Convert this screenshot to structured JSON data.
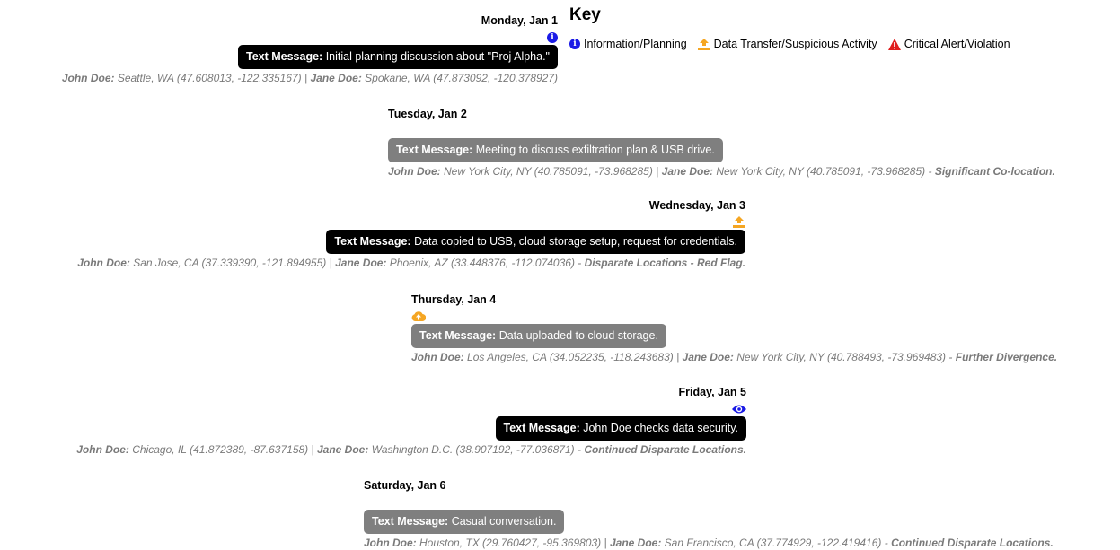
{
  "key": {
    "title": "Key",
    "items": [
      {
        "icon": "info-icon",
        "label": "Information/Planning",
        "color": "#1a1ae6"
      },
      {
        "icon": "upload-icon",
        "label": "Data Transfer/Suspicious Activity",
        "color": "#f5a623"
      },
      {
        "icon": "warning-icon",
        "label": "Critical Alert/Violation",
        "color": "#e01e1e"
      }
    ]
  },
  "events": [
    {
      "date": "Monday, Jan 1",
      "icon": "info-icon",
      "message_prefix": "Text Message:",
      "message": "Initial planning discussion about \"Proj Alpha.\"",
      "john_label": "John Doe:",
      "john_loc": "Seattle, WA (47.608013, -122.335167)",
      "sep": "|",
      "jane_label": "Jane Doe:",
      "jane_loc": "Spokane, WA (47.873092, -120.378927)",
      "note": ""
    },
    {
      "date": "Tuesday, Jan 2",
      "icon": "",
      "message_prefix": "Text Message:",
      "message": "Meeting to discuss exfiltration plan & USB drive.",
      "john_label": "John Doe:",
      "john_loc": "New York City, NY (40.785091, -73.968285)",
      "sep": "|",
      "jane_label": "Jane Doe:",
      "jane_loc": "New York City, NY (40.785091, -73.968285) -",
      "note": "Significant Co-location."
    },
    {
      "date": "Wednesday, Jan 3",
      "icon": "upload-icon",
      "message_prefix": "Text Message:",
      "message": "Data copied to USB, cloud storage setup, request for credentials.",
      "john_label": "John Doe:",
      "john_loc": "San Jose, CA (37.339390, -121.894955)",
      "sep": "|",
      "jane_label": "Jane Doe:",
      "jane_loc": "Phoenix, AZ (33.448376, -112.074036) -",
      "note": "Disparate Locations - Red Flag."
    },
    {
      "date": "Thursday, Jan 4",
      "icon": "cloud-upload-icon",
      "message_prefix": "Text Message:",
      "message": "Data uploaded to cloud storage.",
      "john_label": "John Doe:",
      "john_loc": "Los Angeles, CA (34.052235, -118.243683)",
      "sep": "|",
      "jane_label": "Jane Doe:",
      "jane_loc": "New York City, NY (40.788493, -73.969483) -",
      "note": "Further Divergence."
    },
    {
      "date": "Friday, Jan 5",
      "icon": "eye-icon",
      "message_prefix": "Text Message:",
      "message": "John Doe checks data security.",
      "john_label": "John Doe:",
      "john_loc": "Chicago, IL (41.872389, -87.637158)",
      "sep": "|",
      "jane_label": "Jane Doe:",
      "jane_loc": "Washington D.C. (38.907192, -77.036871) -",
      "note": "Continued Disparate Locations."
    },
    {
      "date": "Saturday, Jan 6",
      "icon": "",
      "message_prefix": "Text Message:",
      "message": "Casual conversation.",
      "john_label": "John Doe:",
      "john_loc": "Houston, TX (29.760427, -95.369803)",
      "sep": "|",
      "jane_label": "Jane Doe:",
      "jane_loc": "San Francisco, CA (37.774929, -122.419416) -",
      "note": "Continued Disparate Locations."
    }
  ],
  "colors": {
    "black_bubble": "#000000",
    "gray_bubble": "#7f7f7f",
    "info": "#1a1ae6",
    "upload": "#f5a623",
    "alert": "#e01e1e"
  }
}
